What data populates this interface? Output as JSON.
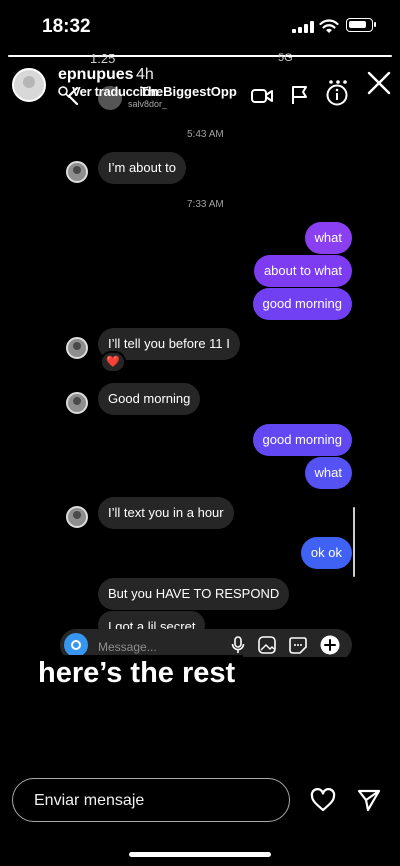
{
  "status": {
    "time": "18:32",
    "battery_level": 0.85
  },
  "story": {
    "username": "epnupues",
    "time_ago": "4h",
    "progress": 1.0,
    "overlay_text": "here’s the rest",
    "reply_placeholder": "Enviar mensaje"
  },
  "inner": {
    "clock": "1:25",
    "network": "5G",
    "translate_label": "Ver traducción",
    "contact_name": "TheBiggestOpp",
    "contact_handle": "salv8dor_",
    "composer_placeholder": "Message..."
  },
  "chat": {
    "timestamps": [
      "5:43 AM",
      "7:33 AM"
    ],
    "messages": [
      {
        "dir": "in",
        "text": "I’m about to"
      },
      {
        "dir": "out",
        "text": "what",
        "color": "#8a3ff0"
      },
      {
        "dir": "out",
        "text": "about to what",
        "color": "#7d3cf1"
      },
      {
        "dir": "out",
        "text": "good morning",
        "color": "#7040f2"
      },
      {
        "dir": "in",
        "text": "I’ll tell you before 11 I"
      },
      {
        "dir": "in",
        "text": "Good morning"
      },
      {
        "dir": "out",
        "text": "good morning",
        "color": "#6148f2"
      },
      {
        "dir": "out",
        "text": "what",
        "color": "#5452f2"
      },
      {
        "dir": "in",
        "text": "I’ll text you in a hour"
      },
      {
        "dir": "out",
        "text": "ok ok",
        "color": "#3f62f4"
      },
      {
        "dir": "in",
        "text": "But you HAVE TO RESPOND"
      },
      {
        "dir": "in",
        "text": "I got a lil secret"
      }
    ],
    "reaction": "❤️"
  },
  "colors": {
    "accent": "#3797f0",
    "incoming_bubble": "#262626",
    "background": "#000000"
  }
}
